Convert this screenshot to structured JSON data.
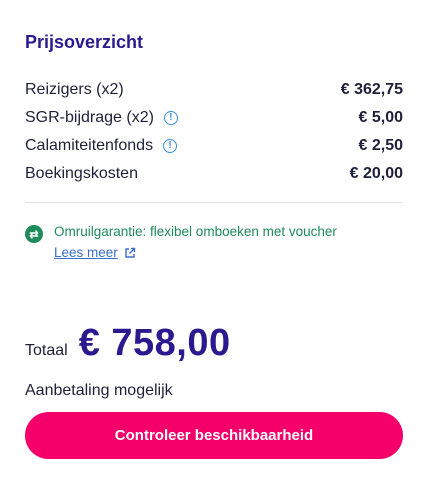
{
  "section": {
    "title": "Prijsoverzicht"
  },
  "price_rows": [
    {
      "label": "Reizigers (x2)",
      "value": "€ 362,75",
      "info_icon": false
    },
    {
      "label": "SGR-bijdrage (x2)",
      "value": "€ 5,00",
      "info_icon": true
    },
    {
      "label": "Calamiteitenfonds",
      "value": "€ 2,50",
      "info_icon": true
    },
    {
      "label": "Boekingskosten",
      "value": "€ 20,00",
      "info_icon": false
    }
  ],
  "guarantee": {
    "icon": "exchange-icon",
    "text": "Omruilgarantie: flexibel omboeken met voucher",
    "link_label": "Lees meer",
    "link_icon": "external-link-icon",
    "color": "#1f8a5a"
  },
  "total": {
    "label": "Totaal",
    "value": "€ 758,00"
  },
  "deposit_note": "Aanbetaling mogelijk",
  "cta": {
    "label": "Controleer beschikbaarheid",
    "color": "#f5006b"
  },
  "colors": {
    "title": "#2b1a8f",
    "info": "#3a8fd8",
    "link": "#3a6fc8"
  }
}
